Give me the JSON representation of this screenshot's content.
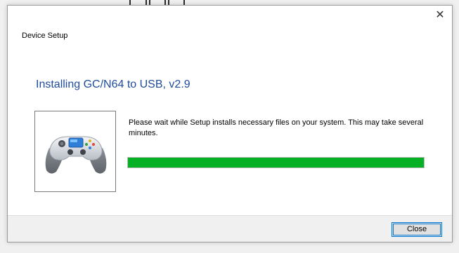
{
  "dialog": {
    "title": "Device Setup",
    "close_glyph": "✕",
    "heading": "Installing GC/N64 to USB, v2.9",
    "status_text": "Please wait while Setup installs necessary files on your system. This may take several minutes.",
    "device_icon": "gamepad-icon",
    "progress_percent": 100,
    "progress_color": "#06b025",
    "heading_color": "#1e4b9b"
  },
  "footer": {
    "close_label": "Close"
  }
}
